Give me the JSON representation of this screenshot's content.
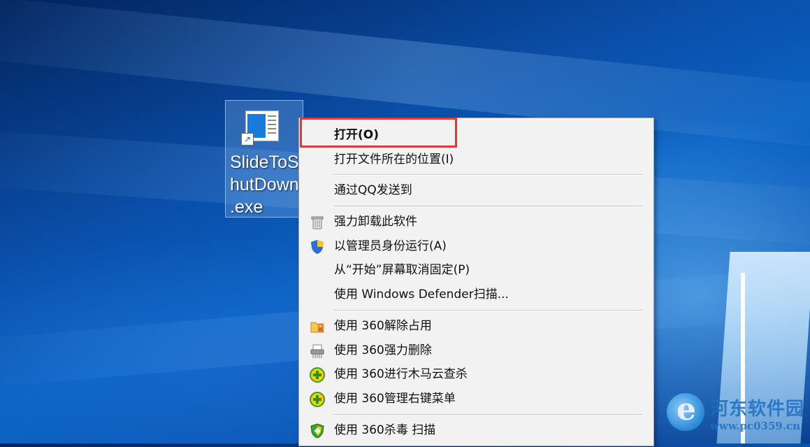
{
  "desktop": {
    "icon_label": "SlideToS\nhutDown\n.exe"
  },
  "context_menu": {
    "items": [
      {
        "label": "打开(O)",
        "icon": "",
        "bold": true
      },
      {
        "label": "打开文件所在的位置(I)",
        "icon": ""
      },
      {
        "label": "通过QQ发送到",
        "icon": ""
      },
      {
        "label": "强力卸载此软件",
        "icon": "trash-icon"
      },
      {
        "label": "以管理员身份运行(A)",
        "icon": "uac-shield-icon"
      },
      {
        "label": "从“开始”屏幕取消固定(P)",
        "icon": ""
      },
      {
        "label": "使用 Windows Defender扫描...",
        "icon": ""
      },
      {
        "label": "使用 360解除占用",
        "icon": "folder-lock-icon"
      },
      {
        "label": "使用 360强力删除",
        "icon": "shredder-icon"
      },
      {
        "label": "使用 360进行木马云查杀",
        "icon": "360-plus-icon"
      },
      {
        "label": "使用 360管理右键菜单",
        "icon": "360-plus-icon"
      },
      {
        "label": "使用 360杀毒 扫描",
        "icon": "360-shield-icon"
      }
    ]
  },
  "watermark": {
    "name": "河东软件园",
    "url": "www.pc0359.cn"
  },
  "colors": {
    "highlight_border": "#d93a3a",
    "menu_background": "#f2f2f2"
  }
}
